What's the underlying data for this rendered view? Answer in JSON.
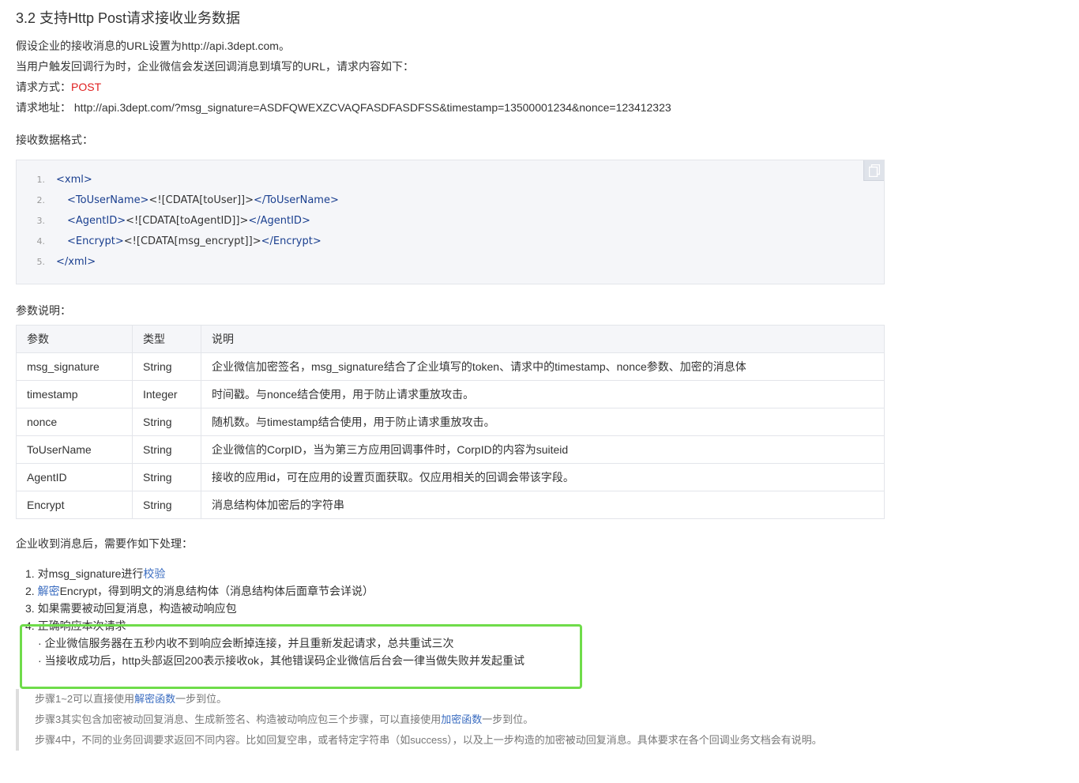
{
  "title": "3.2 支持Http Post请求接收业务数据",
  "intro": {
    "line1": "假设企业的接收消息的URL设置为http://api.3dept.com。",
    "line2": "当用户触发回调行为时，企业微信会发送回调消息到填写的URL，请求内容如下：",
    "method_label": "请求方式：",
    "method_value": "POST",
    "address_label": "请求地址：",
    "address_value": "http://api.3dept.com/?msg_signature=ASDFQWEXZCVAQFASDFASDFSS&timestamp=13500001234&nonce=123412323"
  },
  "format_label": "接收数据格式：",
  "code": {
    "lines": [
      {
        "num": "1.",
        "open": "<xml>",
        "content": "",
        "close": ""
      },
      {
        "num": "2.",
        "open": "<ToUserName>",
        "content": "<![CDATA[toUser]]>",
        "close": "</ToUserName>"
      },
      {
        "num": "3.",
        "open": "<AgentID>",
        "content": "<![CDATA[toAgentID]]>",
        "close": "</AgentID>"
      },
      {
        "num": "4.",
        "open": "<Encrypt>",
        "content": "<![CDATA[msg_encrypt]]>",
        "close": "</Encrypt>"
      },
      {
        "num": "5.",
        "open": "</xml>",
        "content": "",
        "close": ""
      }
    ]
  },
  "params_label": "参数说明：",
  "params_table": {
    "headers": [
      "参数",
      "类型",
      "说明"
    ],
    "rows": [
      [
        "msg_signature",
        "String",
        "企业微信加密签名，msg_signature结合了企业填写的token、请求中的timestamp、nonce参数、加密的消息体"
      ],
      [
        "timestamp",
        "Integer",
        "时间戳。与nonce结合使用，用于防止请求重放攻击。"
      ],
      [
        "nonce",
        "String",
        "随机数。与timestamp结合使用，用于防止请求重放攻击。"
      ],
      [
        "ToUserName",
        "String",
        "企业微信的CorpID，当为第三方应用回调事件时，CorpID的内容为suiteid"
      ],
      [
        "AgentID",
        "String",
        "接收的应用id，可在应用的设置页面获取。仅应用相关的回调会带该字段。"
      ],
      [
        "Encrypt",
        "String",
        "消息结构体加密后的字符串"
      ]
    ]
  },
  "after_label": "企业收到消息后，需要作如下处理：",
  "steps": {
    "s1_prefix": "1. 对msg_signature进行",
    "s1_link": "校验",
    "s2_prefix": "2. ",
    "s2_link": "解密",
    "s2_suffix": "Encrypt，得到明文的消息结构体（消息结构体后面章节会详说）",
    "s3": "3. 如果需要被动回复消息，构造被动响应包",
    "s4": "4. 正确响应本次请求",
    "s4_sub1": "· 企业微信服务器在五秒内收不到响应会断掉连接，并且重新发起请求，总共重试三次",
    "s4_sub2": "· 当接收成功后，http头部返回200表示接收ok，其他错误码企业微信后台会一律当做失败并发起重试"
  },
  "note": {
    "l1_prefix": "步骤1~2可以直接使用",
    "l1_link": "解密函数",
    "l1_suffix": "一步到位。",
    "l2_prefix": "步骤3其实包含加密被动回复消息、生成新签名、构造被动响应包三个步骤，可以直接使用",
    "l2_link": "加密函数",
    "l2_suffix": "一步到位。",
    "l3": "步骤4中，不同的业务回调要求返回不同内容。比如回复空串，或者特定字符串（如success），以及上一步构造的加密被动回复消息。具体要求在各个回调业务文档会有说明。"
  },
  "colors": {
    "post": "#e02020",
    "link": "#3a6cc0",
    "highlight": "#6fdc4a",
    "code_tag": "#1a3f8f"
  }
}
